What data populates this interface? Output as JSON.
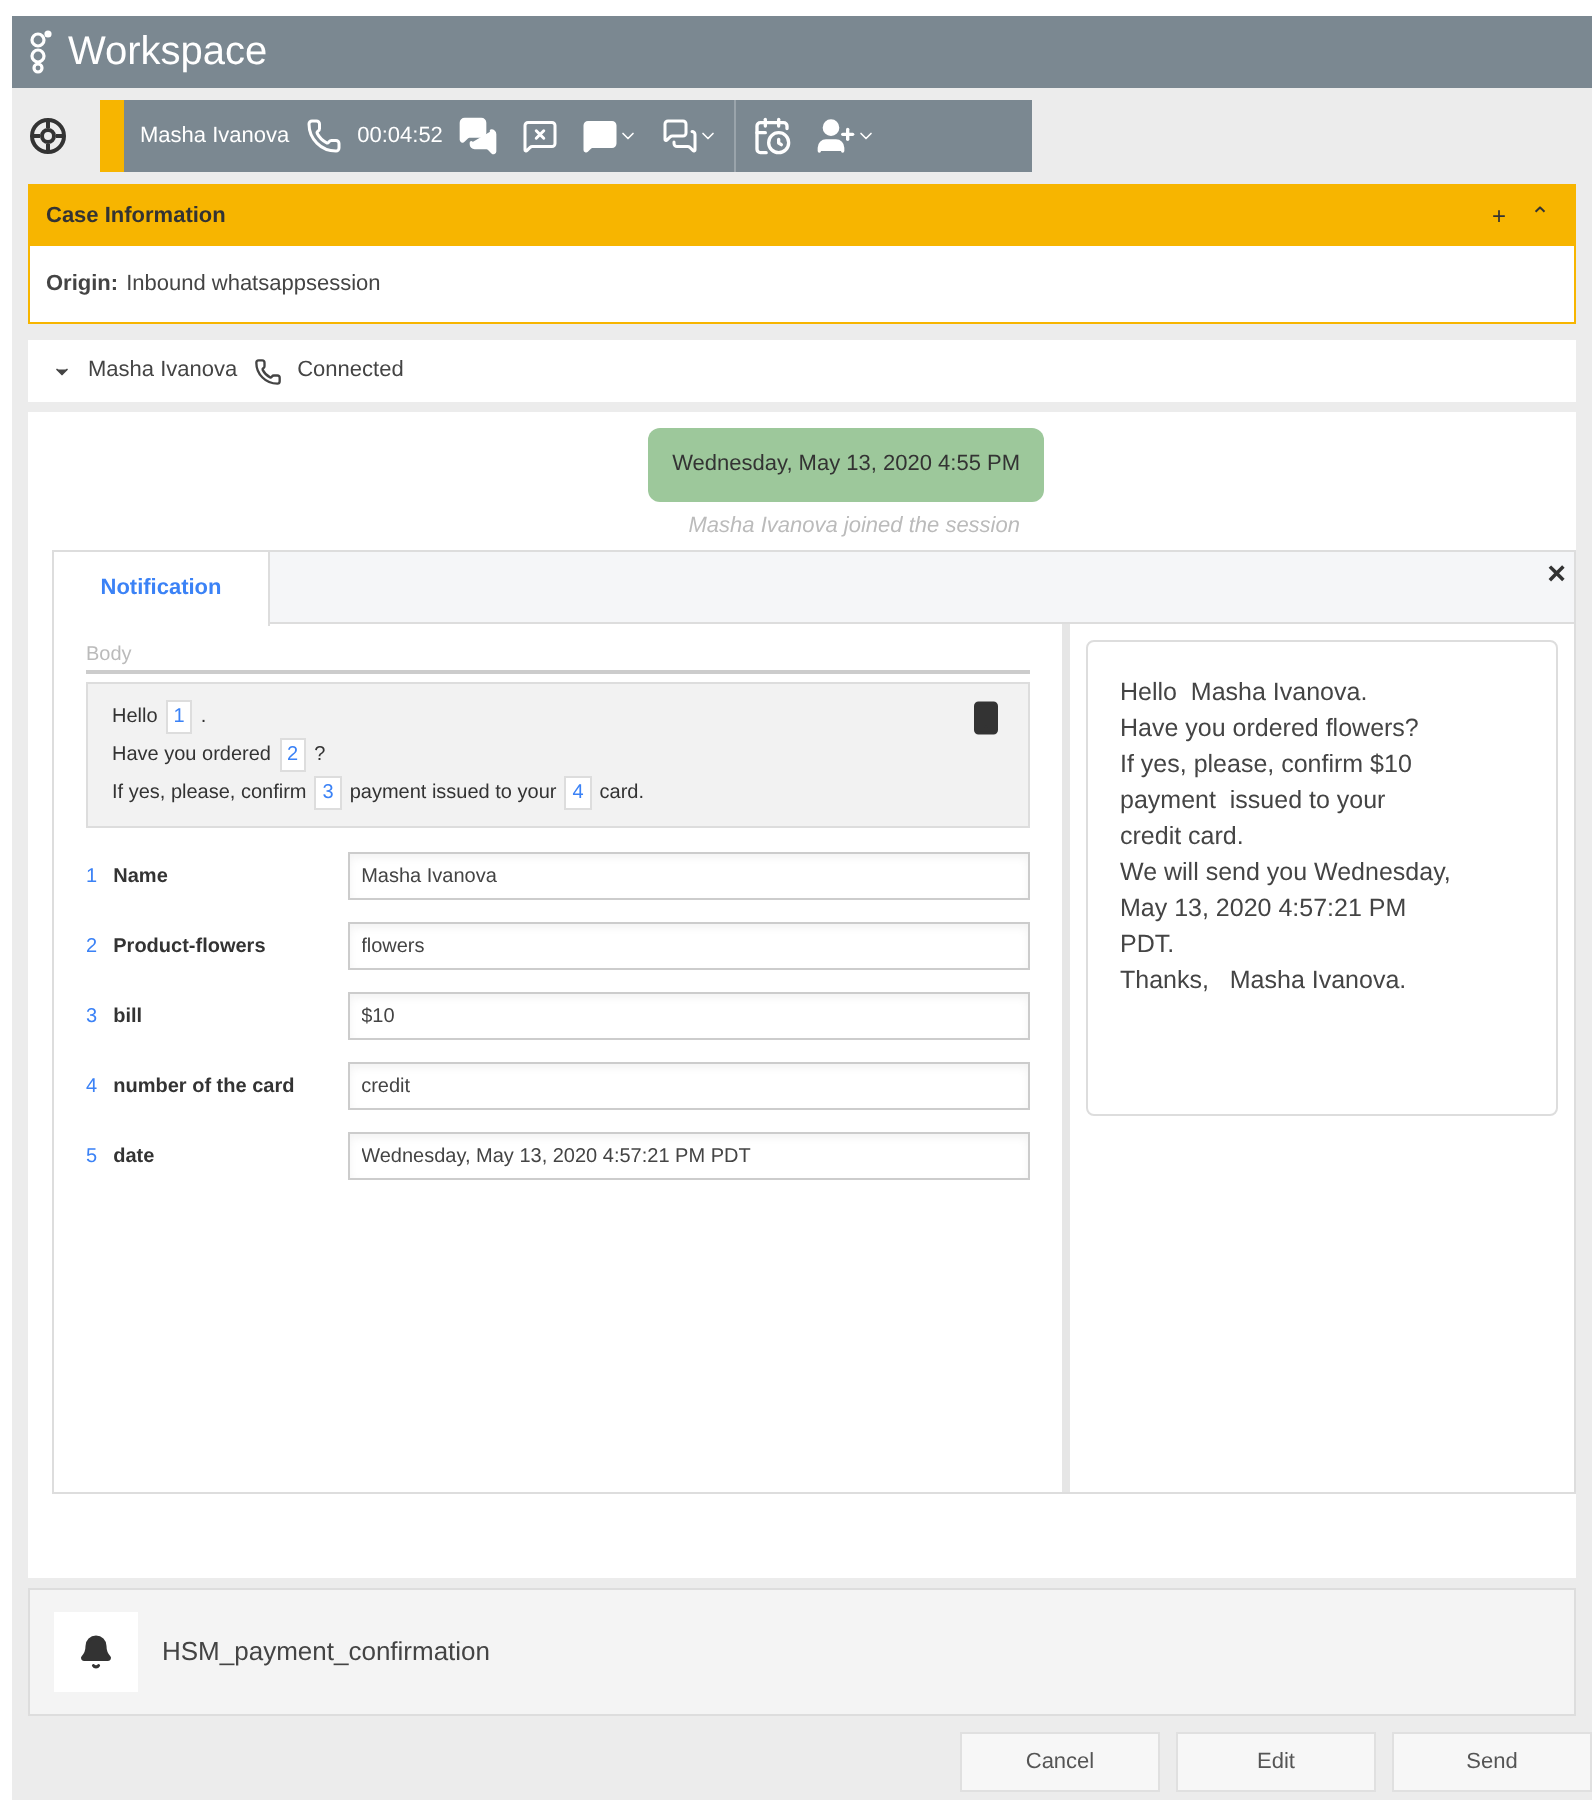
{
  "window": {
    "title": "Workspace"
  },
  "interaction": {
    "contact": "Masha Ivanova",
    "timer": "00:04:52"
  },
  "case_info": {
    "title": "Case Information",
    "expand": "+",
    "collapse": "⌃",
    "origin_label": "Origin:",
    "origin_value": "Inbound whatsappsession"
  },
  "party": {
    "name": "Masha Ivanova",
    "status": "Connected",
    "expanded": true
  },
  "transcript": {
    "date_bubble": "Wednesday, May 13, 2020 4:55 PM",
    "event": "*Masha Ivanova* joined the session"
  },
  "notification": {
    "tabs": [
      {
        "label": "Notification",
        "selected": true
      }
    ],
    "close": "×",
    "body_label": "Body",
    "body_lines": [
      [
        {
          "kind": "text",
          "text": "Hello"
        },
        {
          "kind": "slot",
          "text": "1"
        },
        {
          "kind": "text",
          "text": "."
        }
      ],
      [
        {
          "kind": "text",
          "text": "Have you ordered"
        },
        {
          "kind": "slot",
          "text": "2"
        },
        {
          "kind": "text",
          "text": "?"
        }
      ],
      [
        {
          "kind": "text",
          "text": "If yes, please, confirm"
        },
        {
          "kind": "slot",
          "text": "3"
        },
        {
          "kind": "text",
          "text": "payment  issued to your"
        },
        {
          "kind": "slot",
          "text": "4"
        },
        {
          "kind": "text",
          "text": "card."
        }
      ]
    ],
    "fields": [
      {
        "index": "1",
        "label": "Name",
        "value": "Masha Ivanova"
      },
      {
        "index": "2",
        "label": "Product-flowers",
        "value": "flowers"
      },
      {
        "index": "3",
        "label": "bill",
        "value": "$10"
      },
      {
        "index": "4",
        "label": "number of the card",
        "value": "credit"
      },
      {
        "index": "5",
        "label": "date",
        "value": "Wednesday, May 13, 2020 4:57:21 PM PDT"
      }
    ],
    "preview_lines": [
      "Hello  Masha Ivanova.",
      "Have you ordered flowers?",
      "If yes, please, confirm $10",
      "payment  issued to your",
      "credit card.",
      "We will send you Wednesday,",
      "May 13, 2020 4:57:21 PM",
      "PDT.",
      "Thanks,   Masha Ivanova."
    ]
  },
  "template": {
    "name": "HSM_payment_confirmation"
  },
  "buttons": [
    "Cancel",
    "Edit",
    "Send"
  ]
}
